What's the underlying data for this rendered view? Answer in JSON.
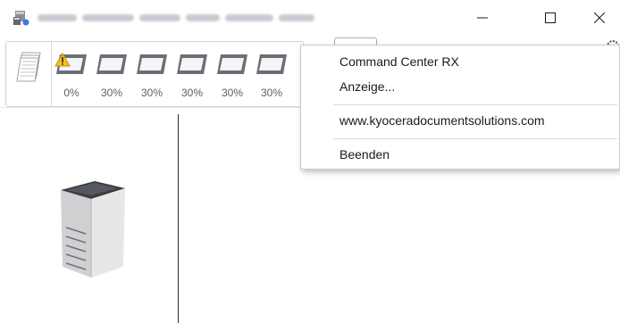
{
  "window": {
    "title_blurred": true,
    "controls": {
      "minimize_icon": "minimize-icon",
      "maximize_icon": "maximize-icon",
      "close_icon": "close-icon"
    }
  },
  "toolbar": {
    "trays": [
      {
        "percent": "0%",
        "warning": true
      },
      {
        "percent": "30%",
        "warning": false
      },
      {
        "percent": "30%",
        "warning": false
      },
      {
        "percent": "30%",
        "warning": false
      },
      {
        "percent": "30%",
        "warning": false
      },
      {
        "percent": "30%",
        "warning": false
      }
    ]
  },
  "context_menu": {
    "items": [
      {
        "label": "Command Center RX"
      },
      {
        "label": "Anzeige..."
      },
      {
        "label": "www.kyoceradocumentsolutions.com"
      },
      {
        "label": "Beenden"
      }
    ]
  },
  "colors": {
    "menu_border": "#c7cacf",
    "warning_yellow": "#f2c218",
    "tray_gray": "#6b6f75"
  }
}
